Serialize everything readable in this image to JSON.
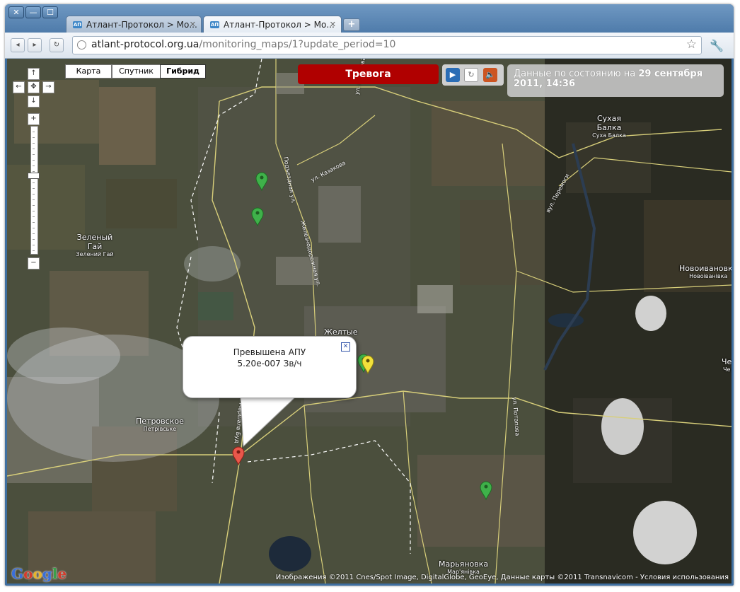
{
  "browser": {
    "window_controls": {
      "close": "✕",
      "minimize": "—",
      "maximize": "☐"
    },
    "tabs": [
      {
        "favicon": "АП",
        "label": "Атлант-Протокол > Мо...",
        "close": "✕",
        "active": false
      },
      {
        "favicon": "АП",
        "label": "Атлант-Протокол > Мо...",
        "close": "✕",
        "active": true
      }
    ],
    "new_tab": "+",
    "nav": {
      "back": "◂",
      "forward": "▸",
      "reload": "↻"
    },
    "url": {
      "host": "atlant-protocol.org.ua",
      "path": "/monitoring_maps/1?update_period=10"
    },
    "star_icon": "☆",
    "wrench_icon": "🔧"
  },
  "map": {
    "type_buttons": [
      {
        "label": "Карта",
        "active": false
      },
      {
        "label": "Спутник",
        "active": false
      },
      {
        "label": "Гибрид",
        "active": true
      }
    ],
    "pan": {
      "up": "↑",
      "down": "↓",
      "left": "←",
      "right": "→",
      "center": "✥"
    },
    "zoom": {
      "in": "+",
      "out": "−",
      "level_fraction": 0.39
    },
    "alarm_button": "Тревога",
    "controls": [
      {
        "icon": "play-icon",
        "glyph": "▶",
        "color": "#2a6db5"
      },
      {
        "icon": "refresh-icon",
        "glyph": "↻",
        "color": "#777777"
      },
      {
        "icon": "sound-icon",
        "glyph": "🔈",
        "color": "#cc5522"
      }
    ],
    "status": {
      "prefix": "Данные по состоянию на ",
      "date": "29 сентября 2011, 14:36"
    },
    "popup": {
      "line1": "Превышена АПУ",
      "line2": "5.20e-007 Зв/ч",
      "close": "✕"
    },
    "places": [
      {
        "name": "Сухая Балка",
        "sub": "Суха Балка"
      },
      {
        "name": "Зеленый Гай",
        "sub": "Зелений Гай"
      },
      {
        "name": "Новоивановка",
        "sub": "Новоіванівка"
      },
      {
        "name": "Желтые",
        "sub": ""
      },
      {
        "name": "Петровское",
        "sub": "Петрівське"
      },
      {
        "name": "Марьяновка",
        "sub": "Мар'янівка"
      },
      {
        "name": "Че",
        "sub": "Че"
      }
    ],
    "roads": [
      "ул. Казакова",
      "ул. Казакова",
      "Подъездная ул.",
      "Железнодорожная ул.",
      "вул. Перемоги",
      "ул. Потапова",
      "ул. Маршала Буд"
    ],
    "markers": [
      {
        "color": "green"
      },
      {
        "color": "green"
      },
      {
        "color": "green"
      },
      {
        "color": "yellow"
      },
      {
        "color": "red"
      },
      {
        "color": "green"
      }
    ],
    "google_logo": "Google",
    "copyright": "Изображения ©2011 Cnes/Spot Image, DigitalGlobe, GeoEye, Данные карты ©2011 Transnavicom - Условия использования"
  }
}
